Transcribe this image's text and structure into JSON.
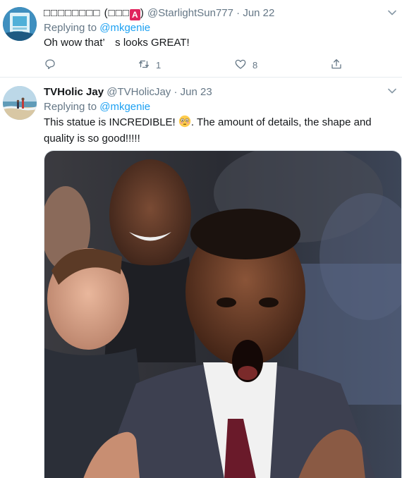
{
  "tweets": [
    {
      "display_name": "□□□□□□□□ (□□□",
      "display_name_end": ")",
      "badge_letter": "A",
      "handle": "@StarlightSun777",
      "dot": "·",
      "date": "Jun 22",
      "replying_prefix": "Replying to",
      "replying_mention": "@mkgenie",
      "text": "Oh wow that’　s looks GREAT!",
      "actions": {
        "reply_count": "",
        "retweet_count": "1",
        "like_count": "8"
      }
    },
    {
      "display_name": "TVHolic Jay",
      "handle": "@TVHolicJay",
      "dot": "·",
      "date": "Jun 23",
      "replying_prefix": "Replying to",
      "replying_mention": "@mkgenie",
      "text_before_emoji": "This statue is INCREDIBLE!",
      "text_after_emoji": ". The amount of details, the shape and quality is so good!!!!!",
      "media_type": "animated-gif"
    }
  ],
  "colors": {
    "accent": "#1da1f2",
    "muted": "#657786",
    "text": "#14171a",
    "divider": "#e6ecf0",
    "badge": "#e0245e"
  },
  "icons": [
    "reply-icon",
    "retweet-icon",
    "like-icon",
    "share-icon",
    "caret-down-icon",
    "flushed-face-emoji"
  ]
}
